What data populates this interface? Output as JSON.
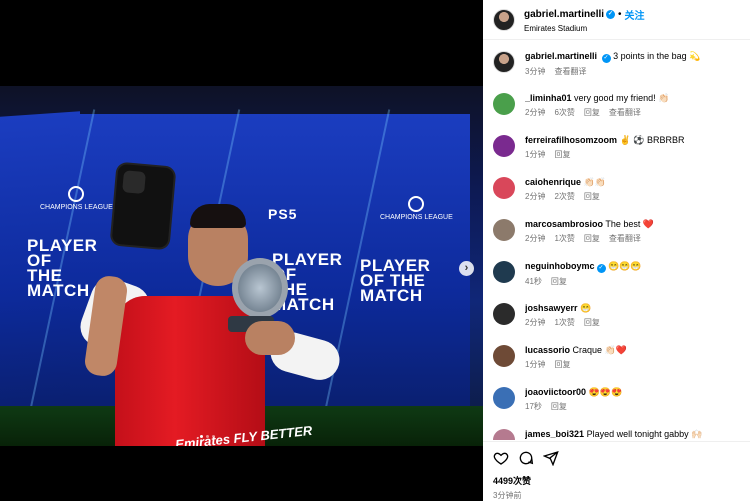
{
  "header": {
    "username": "gabriel.martinelli",
    "separator": "•",
    "follow_label": "关注",
    "location": "Emirates Stadium"
  },
  "caption": {
    "username": "gabriel.martinelli",
    "text": "3 points in the bag 💫",
    "time": "3分钟",
    "translate": "查看翻译"
  },
  "photo": {
    "potm_text": "PLAYER OF THE MATCH",
    "cl_text": "CHAMPIONS LEAGUE",
    "ps5_text": "PS5",
    "shirt_text": "Emirates FLY BETTER"
  },
  "comments": [
    {
      "username": "_liminha01",
      "text": "very good my friend! 👏🏻",
      "time": "2分钟",
      "likes": "6次赞",
      "reply": "回复",
      "translate": "查看翻译",
      "avatar_color": "#4a9f4b",
      "verified": false
    },
    {
      "username": "ferreirafilhosomzoom",
      "text": "✌️ ⚽ BRBRBR",
      "time": "1分钟",
      "likes": "",
      "reply": "回复",
      "translate": "",
      "avatar_color": "#7a2a8f",
      "verified": false
    },
    {
      "username": "caiohenrique",
      "text": "👏🏻👏🏻",
      "time": "2分钟",
      "likes": "2次赞",
      "reply": "回复",
      "translate": "",
      "avatar_color": "#d9475a",
      "verified": false
    },
    {
      "username": "marcosambrosioo",
      "text": "The best ❤️",
      "time": "2分钟",
      "likes": "1次赞",
      "reply": "回复",
      "translate": "查看翻译",
      "avatar_color": "#8c7a6b",
      "verified": false
    },
    {
      "username": "neguinhoboymc",
      "text": "😁😁😁",
      "time": "41秒",
      "likes": "",
      "reply": "回复",
      "translate": "",
      "avatar_color": "#1f3a4f",
      "verified": true
    },
    {
      "username": "joshsawyerr",
      "text": "😁",
      "time": "2分钟",
      "likes": "1次赞",
      "reply": "回复",
      "translate": "",
      "avatar_color": "#2b2b2b",
      "verified": false
    },
    {
      "username": "lucassorio",
      "text": "Craque 👏🏻❤️",
      "time": "1分钟",
      "likes": "",
      "reply": "回复",
      "translate": "",
      "avatar_color": "#6e4a36",
      "verified": false
    },
    {
      "username": "joaoviictoor00",
      "text": "😍😍😍",
      "time": "17秒",
      "likes": "",
      "reply": "回复",
      "translate": "",
      "avatar_color": "#3a6fb5",
      "verified": false
    },
    {
      "username": "james_boi321",
      "text": "Played well tonight gabby 🙌🏻",
      "time": "",
      "likes": "",
      "reply": "",
      "translate": "",
      "avatar_color": "#b57a8f",
      "verified": false
    }
  ],
  "footer": {
    "likes": "4499次赞",
    "posted": "3分钟前"
  },
  "icons": {
    "like": "heart-icon",
    "comment": "comment-icon",
    "share": "paper-plane-icon",
    "next": "chevron-right-icon",
    "verified": "verified-badge-icon"
  },
  "colors": {
    "accent": "#0095f6",
    "muted": "#737373"
  }
}
